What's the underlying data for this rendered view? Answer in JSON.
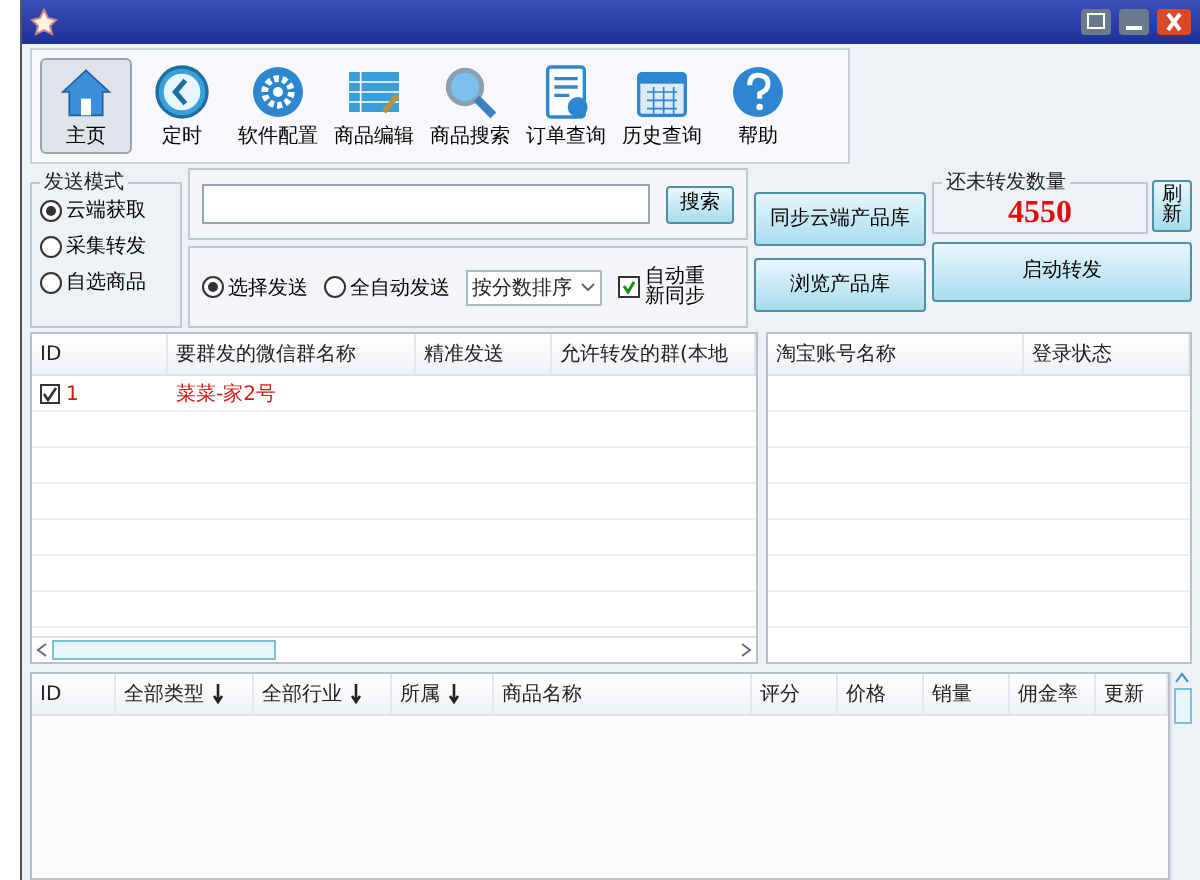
{
  "toolbar": [
    {
      "label": "主页",
      "selected": true
    },
    {
      "label": "定时",
      "selected": false
    },
    {
      "label": "软件配置",
      "selected": false
    },
    {
      "label": "商品编辑",
      "selected": false
    },
    {
      "label": "商品搜索",
      "selected": false
    },
    {
      "label": "订单查询",
      "selected": false
    },
    {
      "label": "历史查询",
      "selected": false
    },
    {
      "label": "帮助",
      "selected": false
    }
  ],
  "send_mode": {
    "title": "发送模式",
    "options": [
      {
        "label": "云端获取",
        "selected": true
      },
      {
        "label": "采集转发",
        "selected": false
      },
      {
        "label": "自选商品",
        "selected": false
      }
    ]
  },
  "search": {
    "button": "搜索"
  },
  "send_options": {
    "radios": [
      {
        "label": "选择发送",
        "selected": true
      },
      {
        "label": "全自动发送",
        "selected": false
      }
    ],
    "sort": "按分数排序",
    "auto_resync": {
      "label": "自动重新同步",
      "checked": true
    }
  },
  "library_buttons": [
    "同步云端产品库",
    "浏览产品库"
  ],
  "pending": {
    "title": "还未转发数量",
    "value": "4550",
    "refresh": "刷新"
  },
  "start_button": "启动转发",
  "group_table": {
    "columns": [
      "ID",
      "要群发的微信群名称",
      "精准发送",
      "允许转发的群(本地"
    ],
    "rows": [
      {
        "checked": true,
        "id": "1",
        "name": "菜菜-家2号"
      }
    ]
  },
  "account_table": {
    "columns": [
      "淘宝账号名称",
      "登录状态"
    ]
  },
  "product_table": {
    "columns": [
      {
        "label": "ID",
        "sortable": false
      },
      {
        "label": "全部类型",
        "sortable": true
      },
      {
        "label": "全部行业",
        "sortable": true
      },
      {
        "label": "所属",
        "sortable": true
      },
      {
        "label": "商品名称",
        "sortable": false
      },
      {
        "label": "评分",
        "sortable": false
      },
      {
        "label": "价格",
        "sortable": false
      },
      {
        "label": "销量",
        "sortable": false
      },
      {
        "label": "佣金率",
        "sortable": false
      },
      {
        "label": "更新",
        "sortable": false
      }
    ]
  }
}
